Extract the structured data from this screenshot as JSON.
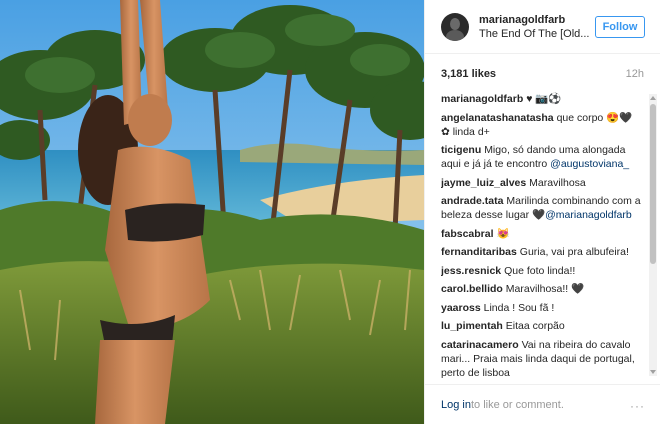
{
  "post": {
    "username": "marianagoldfarb",
    "location": "The End Of The [Old...",
    "follow_label": "Follow",
    "likes": "3,181 likes",
    "time": "12h"
  },
  "comments": [
    {
      "user": "marianagoldfarb",
      "text": "♥ 📷⚽"
    },
    {
      "user": "angelanatashanatasha",
      "text": "que corpo 😍🖤 ✿ linda d+"
    },
    {
      "user": "ticigenu",
      "text": "Migo, só dando uma alongada aqui e já já te encontro",
      "mention": "@augustoviana_"
    },
    {
      "user": "jayme_luiz_alves",
      "text": "Maravilhosa"
    },
    {
      "user": "andrade.tata",
      "text": "Marilinda combinando com a beleza desse lugar",
      "mention": "🖤@marianagoldfarb"
    },
    {
      "user": "fabscabral",
      "text": "😻"
    },
    {
      "user": "fernanditaribas",
      "text": "Guria, vai pra albufeira!"
    },
    {
      "user": "jess.resnick",
      "text": "Que foto linda!!"
    },
    {
      "user": "carol.bellido",
      "text": "Maravilhosa!! 🖤"
    },
    {
      "user": "yaaross",
      "text": "Linda ! Sou fã !"
    },
    {
      "user": "lu_pimentah",
      "text": "Eitaa corpão"
    },
    {
      "user": "catarinacamero",
      "text": "Vai na ribeira do cavalo mari... Praia mais linda daqui de portugal, perto de lisboa"
    }
  ],
  "footer": {
    "login_label": "Log in",
    "rest_label": " to like or comment.",
    "more_label": "···"
  },
  "colors": {
    "accent": "#3897f0",
    "link": "#003569"
  },
  "icons": [
    "avatar",
    "more-options-icon"
  ]
}
